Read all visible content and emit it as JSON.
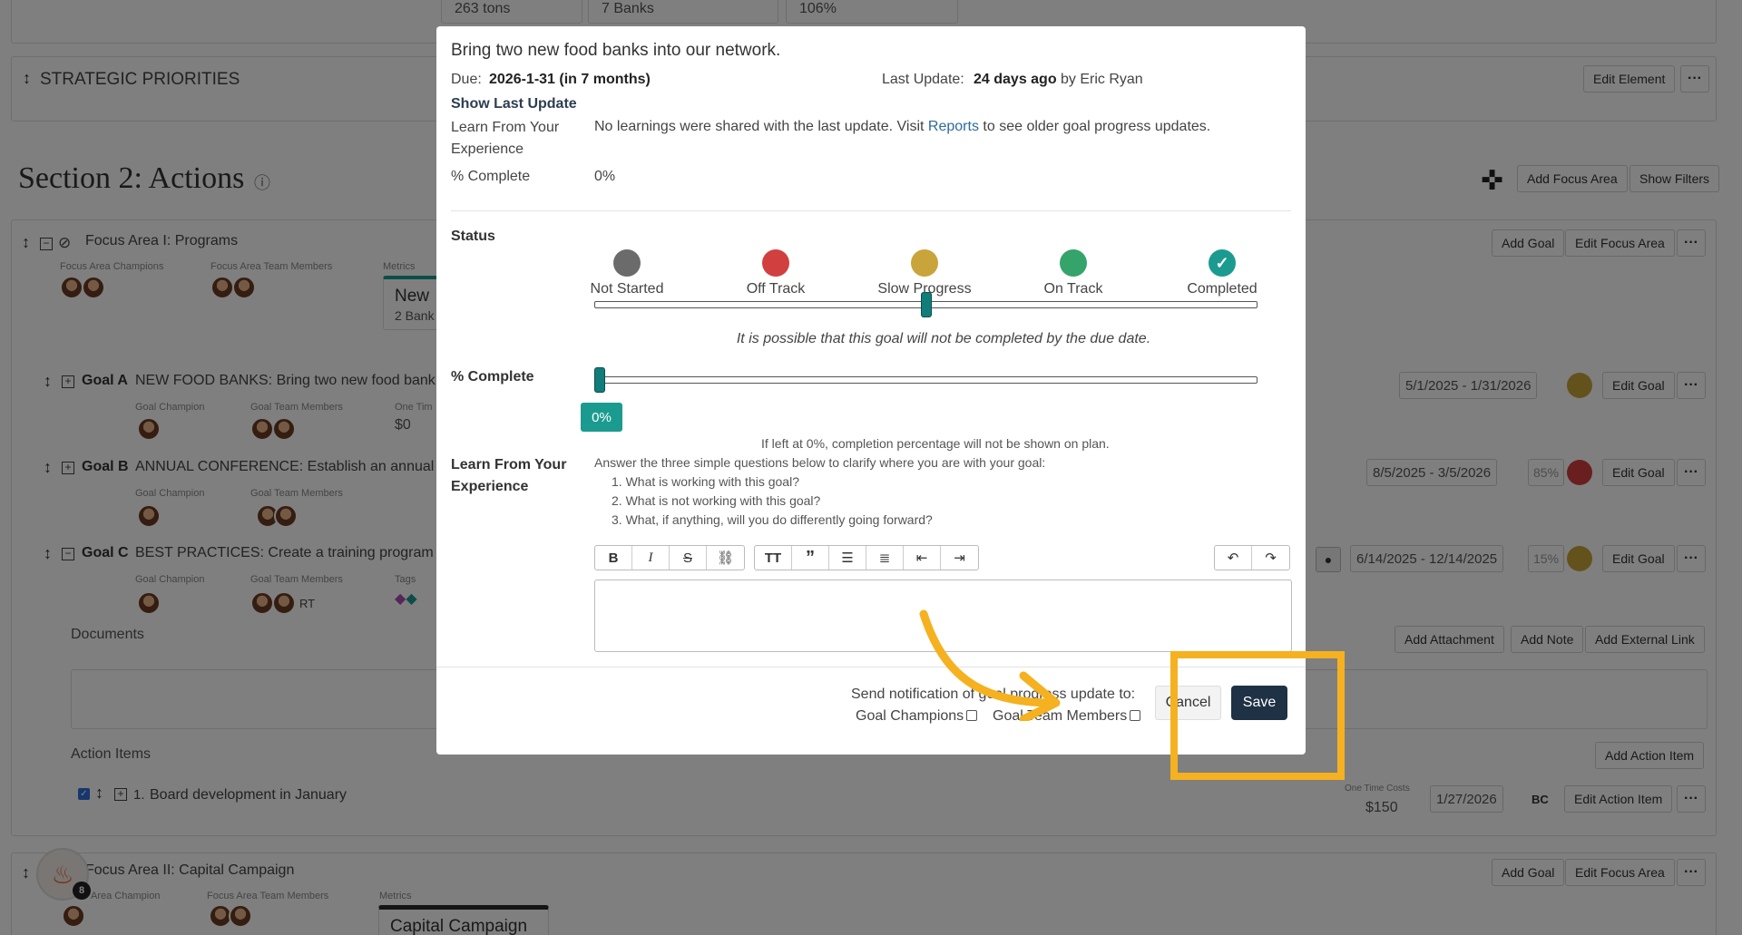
{
  "background": {
    "metric_tiles": [
      "263 tons",
      "7 Banks",
      "106%"
    ],
    "strategic_priorities": "STRATEGIC PRIORITIES",
    "edit_element": "Edit Element",
    "more": "···",
    "section_title": "Section 2: Actions",
    "info_icon": "ⓘ",
    "add_focus_area": "Add Focus Area",
    "show_filters": "Show Filters",
    "focus_area_1": {
      "title": "Focus Area I: Programs",
      "champions_label": "Focus Area Champions",
      "team_label": "Focus Area Team Members",
      "metrics_label": "Metrics",
      "metric_title": "New",
      "metric_sub": "2 Bank",
      "add_goal": "Add Goal",
      "edit_focus_area": "Edit Focus Area"
    },
    "goals": [
      {
        "code": "Goal A",
        "title": "NEW FOOD BANKS: Bring two new food bank",
        "champion_label": "Goal Champion",
        "team_label": "Goal Team Members",
        "cost_label": "One Tim",
        "cost": "$0",
        "dates": "5/1/2025 - 1/31/2026",
        "pct": "",
        "edit": "Edit Goal"
      },
      {
        "code": "Goal B",
        "title": "ANNUAL CONFERENCE: Establish an annual",
        "champion_label": "Goal Champion",
        "team_label": "Goal Team Members",
        "dates": "8/5/2025 - 3/5/2026",
        "pct": "85%",
        "edit": "Edit Goal"
      },
      {
        "code": "Goal C",
        "title": "BEST PRACTICES: Create a training program",
        "champion_label": "Goal Champion",
        "team_label": "Goal Team Members",
        "tags_label": "Tags",
        "initials": "RT",
        "dates": "6/14/2025 - 12/14/2025",
        "pct": "15%",
        "edit": "Edit Goal"
      }
    ],
    "documents": "Documents",
    "add_attachment": "Add Attachment",
    "add_note": "Add Note",
    "add_external_link": "Add External Link",
    "action_items": "Action Items",
    "add_action_item": "Add Action Item",
    "action_item": {
      "number": "1.",
      "title": "Board development in January",
      "cost_label": "One Time Costs",
      "cost": "$150",
      "date": "1/27/2026",
      "owner": "BC",
      "edit": "Edit Action Item"
    },
    "focus_area_2": {
      "title": "Focus Area II: Capital Campaign",
      "champion_label": "Area Champion",
      "team_label": "Focus Area Team Members",
      "metrics_label": "Metrics",
      "metric_title": "Capital Campaign",
      "add_goal": "Add Goal",
      "edit_focus_area": "Edit Focus Area"
    },
    "fab_badge": "8"
  },
  "modal": {
    "title": "Bring two new food banks into our network.",
    "due_label": "Due:",
    "due_value": "2026-1-31 (in 7 months)",
    "last_update_label": "Last Update:",
    "last_update_value": "24 days ago",
    "last_update_by": "by Eric Ryan",
    "show_last_update": "Show Last Update",
    "learn_label": "Learn From Your Experience",
    "learn_text_pre": "No learnings were shared with the last update. Visit",
    "learn_text_link": "Reports",
    "learn_text_post": "to see older goal progress updates.",
    "pct_label": "% Complete",
    "pct_value": "0%",
    "status_label": "Status",
    "statuses": [
      {
        "label": "Not Started",
        "color": "#6b6b6b"
      },
      {
        "label": "Off Track",
        "color": "#d23f3f"
      },
      {
        "label": "Slow Progress",
        "color": "#c9a43a"
      },
      {
        "label": "On Track",
        "color": "#35a46a"
      },
      {
        "label": "Completed",
        "color": "#1b9b90"
      }
    ],
    "status_selected": "Slow Progress",
    "status_message": "It is possible that this goal will not be completed by the due date.",
    "pct_complete_label": "% Complete",
    "pct_complete_value": 0,
    "pct_badge": "0%",
    "pct_note": "If left at 0%, completion percentage will not be shown on plan.",
    "learn2_label": "Learn From Your Experience",
    "questions_intro": "Answer the three simple questions below to clarify where you are with your goal:",
    "questions": [
      "1. What is working with this goal?",
      "2. What is not working with this goal?",
      "3. What, if anything, will you do differently going forward?"
    ],
    "toolbar": [
      "bold-icon",
      "italic-icon",
      "strikethrough-icon",
      "link-icon",
      "text-size-icon",
      "quote-icon",
      "bullet-list-icon",
      "numbered-list-icon",
      "outdent-icon",
      "indent-icon",
      "undo-icon",
      "redo-icon"
    ],
    "notify_label": "Send notification of goal progress update to:",
    "goal_champions": "Goal Champions",
    "goal_team_members": "Goal Team Members",
    "cancel": "Cancel",
    "save": "Save"
  },
  "colors": {
    "highlight": "#f5b120",
    "save_bg": "#1f3144",
    "teal": "#1b9b90"
  }
}
